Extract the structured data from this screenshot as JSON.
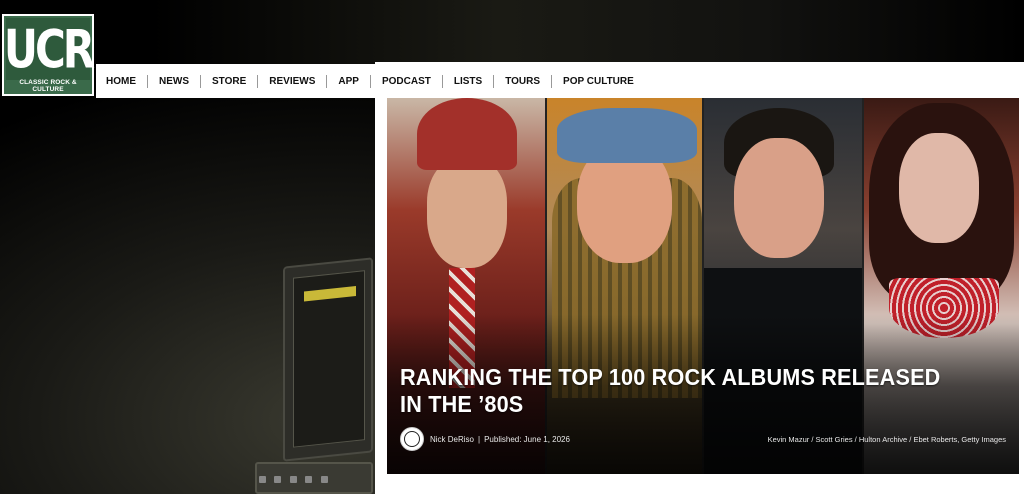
{
  "logo": {
    "text": "UCR",
    "tagline": "CLASSIC ROCK & CULTURE"
  },
  "nav": {
    "items": [
      "HOME",
      "NEWS",
      "STORE",
      "REVIEWS",
      "APP",
      "PODCAST",
      "LISTS",
      "TOURS",
      "POP CULTURE"
    ]
  },
  "hero": {
    "title": "RANKING THE TOP 100 ROCK ALBUMS RELEASED IN THE ’80S",
    "author": "Nick DeRiso",
    "separator": "|",
    "published": "Published: June 1, 2026",
    "credit": "Kevin Mazur / Scott Gries / Hulton Archive / Ebet Roberts, Getty Images"
  },
  "colors": {
    "logo_green": "#2e5a3c",
    "nav_bg": "#ffffff",
    "page_bg": "#000000"
  },
  "icons": {
    "avatar": "author-avatar-icon"
  }
}
